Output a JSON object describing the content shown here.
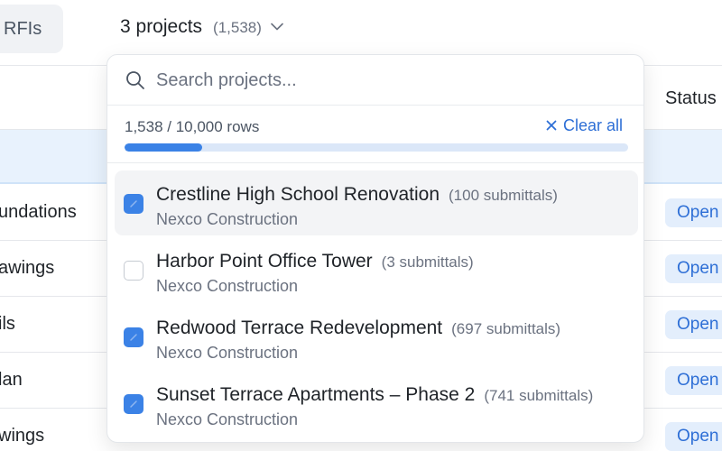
{
  "tabs": {
    "rfis_label": "RFIs"
  },
  "project_selector": {
    "label": "3 projects",
    "total_count": "(1,538)"
  },
  "table": {
    "status_header": "Status",
    "rows": [
      {
        "name_fragment": "undations",
        "status": "Open"
      },
      {
        "name_fragment": "awings",
        "status": "Open"
      },
      {
        "name_fragment": "ils",
        "status": "Open"
      },
      {
        "name_fragment": "lan",
        "status": "Open"
      },
      {
        "name_fragment": "wings",
        "status": "Open"
      }
    ]
  },
  "dropdown": {
    "search_placeholder": "Search projects...",
    "rows_text": "1,538 / 10,000 rows",
    "rows_fraction": 0.1538,
    "clear_all_label": "Clear all",
    "accent_color": "#3b82e6",
    "projects": [
      {
        "name": "Crestline High School Renovation",
        "count": "(100 submittals)",
        "company": "Nexco Construction",
        "checked": true,
        "hovered": true
      },
      {
        "name": "Harbor Point Office Tower",
        "count": "(3 submittals)",
        "company": "Nexco Construction",
        "checked": false,
        "hovered": false
      },
      {
        "name": "Redwood Terrace Redevelopment",
        "count": "(697 submittals)",
        "company": "Nexco Construction",
        "checked": true,
        "hovered": false
      },
      {
        "name": "Sunset Terrace Apartments – Phase 2",
        "count": "(741 submittals)",
        "company": "Nexco Construction",
        "checked": true,
        "hovered": false
      }
    ]
  }
}
